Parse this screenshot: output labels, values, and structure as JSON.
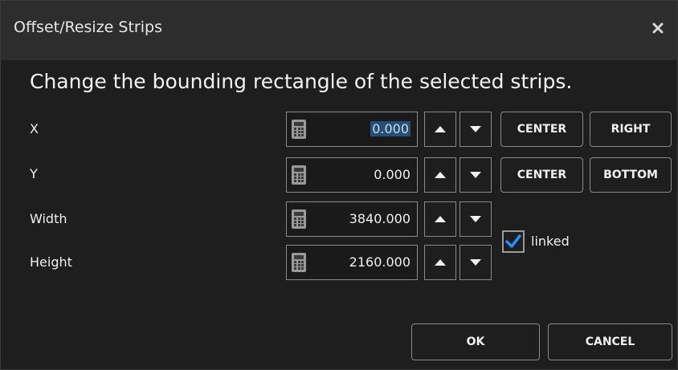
{
  "dialog": {
    "title": "Offset/Resize Strips",
    "close_glyph": "✕",
    "heading": "Change the bounding rectangle of the selected strips."
  },
  "fields": {
    "x": {
      "label": "X",
      "value": "0.000"
    },
    "y": {
      "label": "Y",
      "value": "0.000"
    },
    "width": {
      "label": "Width",
      "value": "3840.000"
    },
    "height": {
      "label": "Height",
      "value": "2160.000"
    }
  },
  "buttons": {
    "x_center": "CENTER",
    "x_right": "RIGHT",
    "y_center": "CENTER",
    "y_bottom": "BOTTOM",
    "ok": "OK",
    "cancel": "CANCEL"
  },
  "linked": {
    "label": "linked",
    "checked": true
  },
  "icons": {
    "calculator": "calculator-icon",
    "spin_up": "triangle-up-icon",
    "spin_down": "triangle-down-icon",
    "check": "checkmark-icon",
    "close": "close-icon"
  },
  "colors": {
    "background": "#1e1e1e",
    "titlebar": "#2d2d2d",
    "border": "#8a8a8a",
    "selection": "#264f78",
    "check_accent": "#1e90ff"
  }
}
